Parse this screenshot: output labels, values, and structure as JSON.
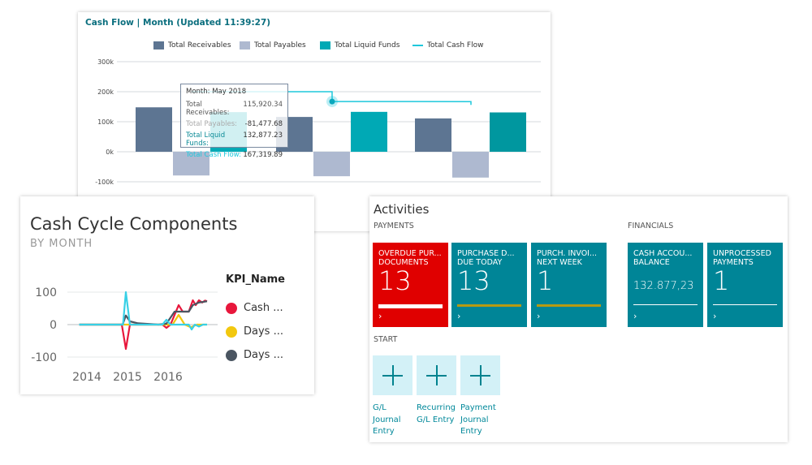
{
  "cash_flow": {
    "title": "Cash Flow | Month (Updated 11:39:27)",
    "legend": [
      "Total Receivables",
      "Total Payables",
      "Total Liquid Funds",
      "Total Cash Flow"
    ],
    "colors": {
      "receivables": "#5d7592",
      "payables": "#aeb9d0",
      "liquid": "#00a9b5",
      "cashflow": "#1ec8dc"
    },
    "tooltip": {
      "month": "Month: May 2018",
      "rows": [
        {
          "label": "Total Receivables:",
          "value": "115,920.34"
        },
        {
          "label": "Total Payables:",
          "value": "-81,477.68"
        },
        {
          "label": "Total Liquid Funds:",
          "value": "132,877.23"
        },
        {
          "label": "Total Cash Flow:",
          "value": "167,319.89"
        }
      ]
    }
  },
  "cash_cycle": {
    "title": "Cash Cycle Components",
    "subtitle": "BY MONTH",
    "legend_title": "KPI_Name",
    "legend": [
      {
        "label": "Cash ...",
        "color": "#e8173c"
      },
      {
        "label": "Days ...",
        "color": "#f2c80f"
      },
      {
        "label": "Days ...",
        "color": "#4a5561"
      }
    ]
  },
  "activities": {
    "title": "Activities",
    "payments_label": "PAYMENTS",
    "financials_label": "FINANCIALS",
    "start_label": "START",
    "tiles": [
      {
        "title1": "OVERDUE PUR...",
        "title2": "DOCUMENTS",
        "value": "13",
        "color": "#e00000",
        "bar": "#ffffff"
      },
      {
        "title1": "PURCHASE D...",
        "title2": "DUE TODAY",
        "value": "13",
        "color": "#008597",
        "bar": "#b59a12"
      },
      {
        "title1": "PURCH. INVOI...",
        "title2": "NEXT WEEK",
        "value": "1",
        "color": "#008597",
        "bar": "#b59a12"
      },
      {
        "title1": "CASH ACCOU...",
        "title2": "BALANCE",
        "value": "132.877,23",
        "color": "#008597",
        "bar": "#ffffff"
      },
      {
        "title1": "UNPROCESSED",
        "title2": "PAYMENTS",
        "value": "1",
        "color": "#008597",
        "bar": "#ffffff"
      }
    ],
    "chevron": "›",
    "start_items": [
      {
        "l1": "G/L",
        "l2": "Journal",
        "l3": "Entry"
      },
      {
        "l1": "Recurring",
        "l2": "G/L Entry",
        "l3": ""
      },
      {
        "l1": "Payment",
        "l2": "Journal",
        "l3": "Entry"
      }
    ]
  },
  "chart_data": [
    {
      "type": "bar",
      "title": "Cash Flow | Month (Updated 11:39:27)",
      "categories": [
        "",
        "May 2018",
        ""
      ],
      "yticks": [
        "300k",
        "200k",
        "100k",
        "0k",
        "-100k"
      ],
      "ylim": [
        -100000,
        300000
      ],
      "grid": true,
      "legend_position": "top",
      "series": [
        {
          "name": "Total Receivables",
          "values": [
            148000,
            115920.34,
            111000
          ]
        },
        {
          "name": "Total Payables",
          "values": [
            -79000,
            -81477.68,
            -86000
          ]
        },
        {
          "name": "Total Liquid Funds",
          "values": [
            132000,
            132877.23,
            131000
          ]
        },
        {
          "name": "Total Cash Flow",
          "type": "line",
          "values": [
            200000,
            167319.89,
            167000
          ]
        }
      ]
    },
    {
      "type": "line",
      "title": "Cash Cycle Components",
      "subtitle": "BY MONTH",
      "xticks": [
        "2014",
        "2015",
        "2016"
      ],
      "yticks": [
        "100",
        "0",
        "-100"
      ],
      "ylim": [
        -100,
        100
      ],
      "legend_title": "KPI_Name",
      "legend_position": "right",
      "series": [
        {
          "name": "Cash ...",
          "color": "#e8173c",
          "points": [
            [
              2013.85,
              0
            ],
            [
              2014.9,
              0
            ],
            [
              2015.0,
              -75
            ],
            [
              2015.1,
              0
            ],
            [
              2015.9,
              0
            ],
            [
              2016.0,
              -10
            ],
            [
              2016.1,
              0
            ],
            [
              2016.3,
              60
            ],
            [
              2016.4,
              40
            ],
            [
              2016.55,
              40
            ],
            [
              2016.65,
              75
            ],
            [
              2016.72,
              60
            ],
            [
              2016.8,
              75
            ],
            [
              2016.88,
              68
            ],
            [
              2016.95,
              74
            ],
            [
              2017.0,
              72
            ]
          ]
        },
        {
          "name": "Days ...",
          "color": "#f2c80f",
          "points": [
            [
              2013.85,
              0
            ],
            [
              2016.15,
              0
            ],
            [
              2016.3,
              30
            ],
            [
              2016.45,
              0
            ],
            [
              2016.6,
              -8
            ],
            [
              2016.75,
              0
            ],
            [
              2017.0,
              0
            ]
          ]
        },
        {
          "name": "Days ...",
          "color": "#4a5561",
          "points": [
            [
              2013.85,
              0
            ],
            [
              2014.92,
              0
            ],
            [
              2015.0,
              28
            ],
            [
              2015.1,
              10
            ],
            [
              2015.3,
              4
            ],
            [
              2015.8,
              0
            ],
            [
              2016.0,
              3
            ],
            [
              2016.2,
              40
            ],
            [
              2016.55,
              40
            ],
            [
              2016.65,
              60
            ],
            [
              2016.8,
              68
            ],
            [
              2017.0,
              72
            ]
          ]
        },
        {
          "color": "#38d0e6",
          "points": [
            [
              2013.85,
              0
            ],
            [
              2014.93,
              0
            ],
            [
              2015.0,
              100
            ],
            [
              2015.1,
              0
            ],
            [
              2015.9,
              0
            ],
            [
              2016.0,
              15
            ],
            [
              2016.1,
              0
            ],
            [
              2016.55,
              0
            ],
            [
              2016.62,
              -15
            ],
            [
              2016.7,
              0
            ],
            [
              2016.8,
              -6
            ],
            [
              2016.9,
              0
            ],
            [
              2017.0,
              0
            ]
          ]
        }
      ]
    }
  ]
}
